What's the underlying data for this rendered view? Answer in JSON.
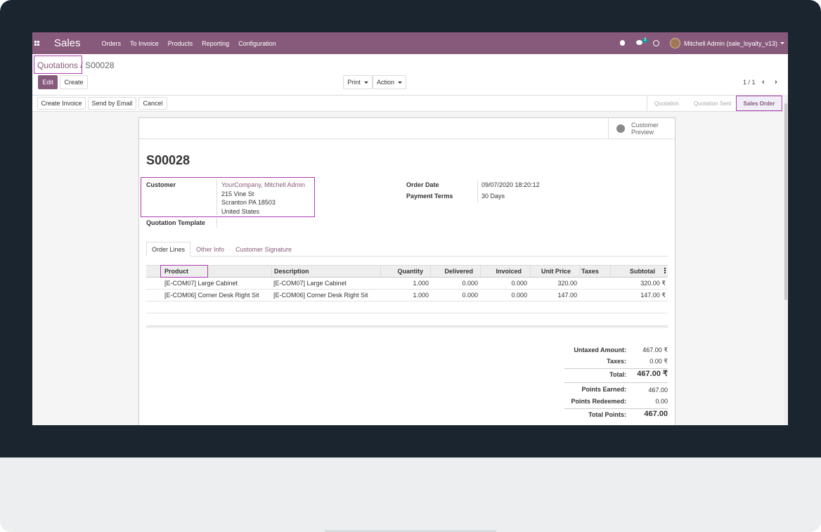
{
  "navbar": {
    "app_name": "Sales",
    "menu": [
      "Orders",
      "To Invoice",
      "Products",
      "Reporting",
      "Configuration"
    ],
    "chat_badge": "3",
    "user": "Mitchell Admin (sale_loyalty_v13)",
    "icons": [
      "apps-grid-icon",
      "bug-icon",
      "chat-icon",
      "clock-icon",
      "user-avatar"
    ]
  },
  "breadcrumb": {
    "parent": "Quotations",
    "separator": " / ",
    "current": "S00028"
  },
  "control": {
    "edit": "Edit",
    "create": "Create",
    "print": "Print",
    "action": "Action",
    "pager": "1 / 1",
    "prev": "‹",
    "next": "›"
  },
  "statusbar": {
    "buttons": [
      "Create Invoice",
      "Send by Email",
      "Cancel"
    ],
    "steps": [
      "Quotation",
      "Quotation Sent",
      "Sales Order"
    ],
    "active_step": "Sales Order"
  },
  "sheet": {
    "preview_line1": "Customer",
    "preview_line2": "Preview",
    "title": "S00028",
    "customer_label": "Customer",
    "customer_name": "YourCompany, Mitchell Admin",
    "address": [
      "215 Vine St",
      "Scranton PA 18503",
      "United States"
    ],
    "template_label": "Quotation Template",
    "order_date_label": "Order Date",
    "order_date": "09/07/2020 18:20:12",
    "payment_terms_label": "Payment Terms",
    "payment_terms": "30 Days"
  },
  "tabs": [
    "Order Lines",
    "Other Info",
    "Customer Signature"
  ],
  "table": {
    "headers": [
      "Product",
      "Description",
      "Quantity",
      "Delivered",
      "Invoiced",
      "Unit Price",
      "Taxes",
      "Subtotal"
    ],
    "rows": [
      [
        "[E-COM07] Large Cabinet",
        "[E-COM07] Large Cabinet",
        "1.000",
        "0.000",
        "0.000",
        "320.00",
        "",
        "320.00 ₹"
      ],
      [
        "[E-COM06] Corner Desk Right Sit",
        "[E-COM06] Corner Desk Right Sit",
        "1.000",
        "0.000",
        "0.000",
        "147.00",
        "",
        "147.00 ₹"
      ]
    ]
  },
  "totals": {
    "untaxed_label": "Untaxed Amount:",
    "untaxed": "467.00 ₹",
    "taxes_label": "Taxes:",
    "taxes": "0.00 ₹",
    "total_label": "Total:",
    "total": "467.00 ₹",
    "earned_label": "Points Earned:",
    "earned": "467.00",
    "redeemed_label": "Points Redeemed:",
    "redeemed": "0.00",
    "total_points_label": "Total Points:",
    "total_points": "467.00"
  },
  "colors": {
    "brand": "#875a7b",
    "highlight": "#b03cb0",
    "bezel": "#1a2530"
  }
}
